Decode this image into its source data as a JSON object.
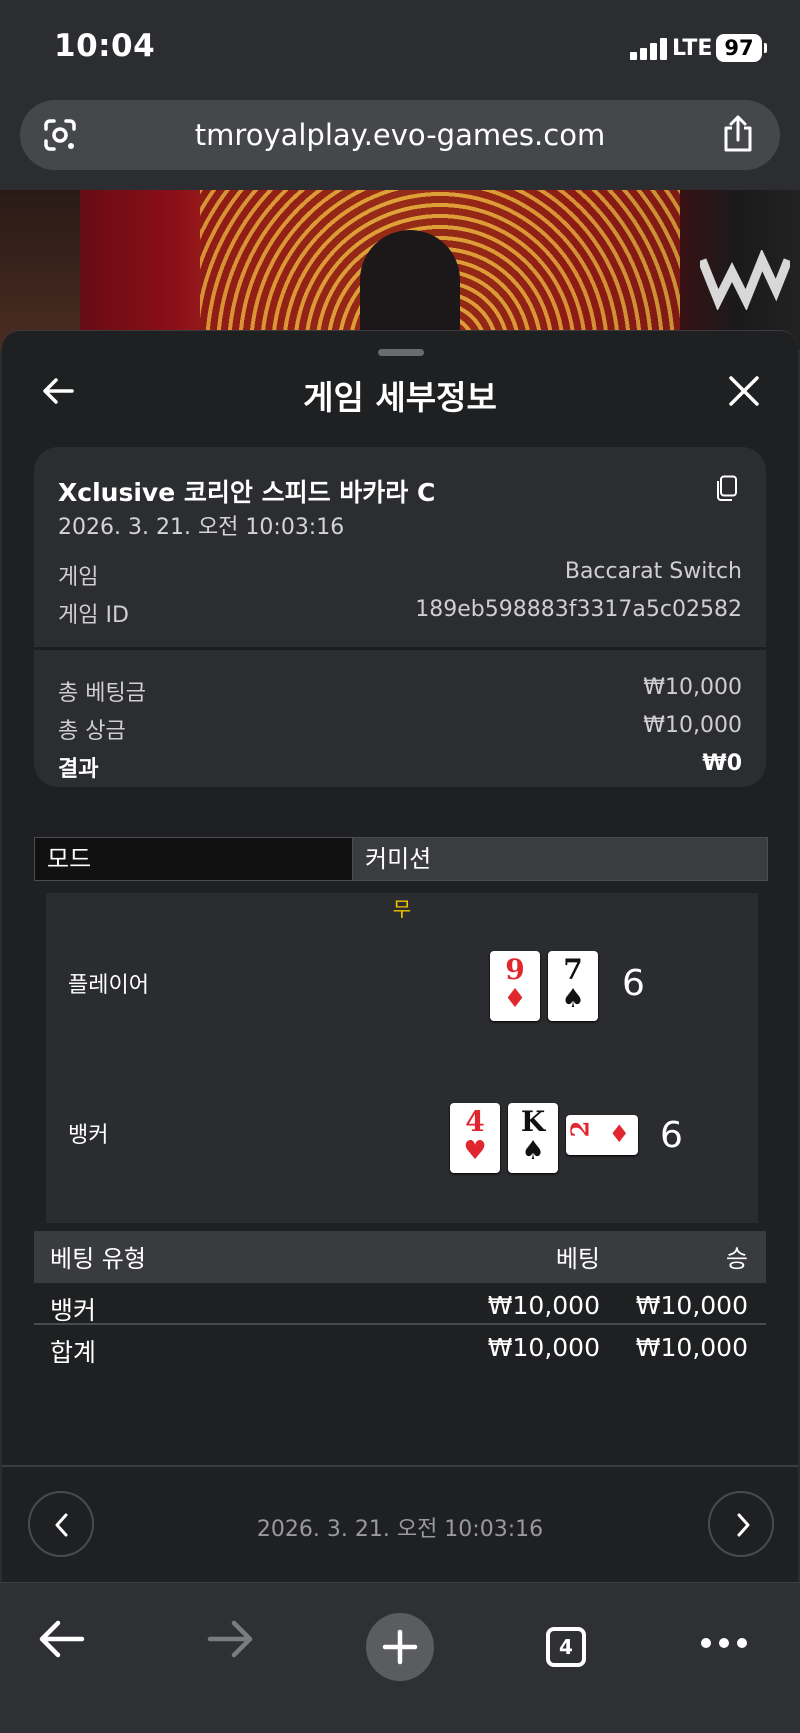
{
  "status_bar": {
    "time": "10:04",
    "network": "LTE",
    "battery": "97"
  },
  "browser": {
    "url": "tmroyalplay.evo-games.com",
    "tabs_count": "4"
  },
  "sheet": {
    "title": "게임 세부정보",
    "card": {
      "game_title": "Xclusive 코리안 스피드 바카라 C",
      "datetime": "2026. 3. 21. 오전 10:03:16",
      "game_label": "게임",
      "game_value": "Baccarat Switch",
      "game_id_label": "게임 ID",
      "game_id_value": "189eb598883f3317a5c02582",
      "total_bet_label": "총 베팅금",
      "total_bet_value": "₩10,000",
      "total_payout_label": "총 상금",
      "total_payout_value": "₩10,000",
      "result_label": "결과",
      "result_value": "₩0"
    },
    "mode": {
      "label": "모드",
      "value": "커미션"
    },
    "hand": {
      "outcome": "무",
      "player": {
        "label": "플레이어",
        "score": "6",
        "cards": [
          {
            "rank": "9",
            "suit": "♦",
            "color": "#e0262e"
          },
          {
            "rank": "7",
            "suit": "♠",
            "color": "#111111"
          }
        ]
      },
      "banker": {
        "label": "뱅커",
        "score": "6",
        "cards": [
          {
            "rank": "4",
            "suit": "♥",
            "color": "#e0262e"
          },
          {
            "rank": "K",
            "suit": "♠",
            "color": "#111111"
          },
          {
            "rank": "2",
            "suit": "♦",
            "color": "#e0262e"
          }
        ]
      }
    },
    "bets": {
      "headers": [
        "베팅 유형",
        "베팅",
        "승"
      ],
      "rows": [
        [
          "뱅커",
          "₩10,000",
          "₩10,000"
        ]
      ],
      "total": [
        "합계",
        "₩10,000",
        "₩10,000"
      ]
    },
    "footer_datetime": "2026. 3. 21. 오전 10:03:16"
  },
  "icons": {
    "lens": "google-lens-icon",
    "share": "share-icon",
    "back": "arrow-left-icon",
    "close": "close-icon",
    "copy": "copy-icon",
    "prev": "chevron-left-icon",
    "next": "chevron-right-icon",
    "browser_back": "arrow-left-icon",
    "browser_forward": "arrow-right-icon",
    "new_tab": "plus-icon",
    "more": "more-horizontal-icon"
  },
  "colors": {
    "tie_outcome": "#f2c200",
    "red_suit": "#e0262e",
    "black_suit": "#111111"
  }
}
